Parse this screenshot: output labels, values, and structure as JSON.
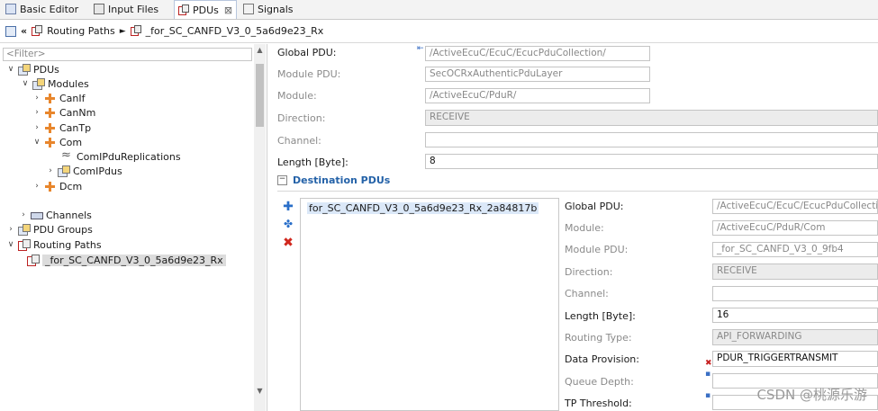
{
  "tabs": [
    {
      "label": "Basic Editor"
    },
    {
      "label": "Input Files"
    },
    {
      "label": "PDUs",
      "close": "⊠"
    },
    {
      "label": "Signals"
    }
  ],
  "breadcrumb": {
    "back": "«",
    "item1": "Routing Paths",
    "sep": "►",
    "item2": "_for_SC_CANFD_V3_0_5a6d9e23_Rx"
  },
  "tree": {
    "filter_placeholder": "<Filter>",
    "nodes": [
      {
        "label": "PDUs"
      },
      {
        "label": "Modules"
      },
      {
        "label": "CanIf"
      },
      {
        "label": "CanNm"
      },
      {
        "label": "CanTp"
      },
      {
        "label": "Com"
      },
      {
        "label": "ComIPduReplications"
      },
      {
        "label": "ComIPdus"
      },
      {
        "label": "Dcm"
      },
      {
        "label": "Channels"
      },
      {
        "label": "PDU Groups"
      },
      {
        "label": "Routing Paths"
      },
      {
        "label": "_for_SC_CANFD_V3_0_5a6d9e23_Rx"
      }
    ]
  },
  "form": {
    "global_pdu": {
      "label": "Global PDU:",
      "value": "/ActiveEcuC/EcuC/EcucPduCollection/"
    },
    "module_pdu": {
      "label": "Module PDU:",
      "value": "SecOCRxAuthenticPduLayer"
    },
    "module": {
      "label": "Module:",
      "value": "/ActiveEcuC/PduR/"
    },
    "direction": {
      "label": "Direction:",
      "value": "RECEIVE"
    },
    "channel": {
      "label": "Channel:",
      "value": ""
    },
    "length": {
      "label": "Length [Byte]:",
      "value": "8"
    }
  },
  "destination": {
    "title": "Destination PDUs",
    "collapse": "−",
    "item": "for_SC_CANFD_V3_0_5a6d9e23_Rx_2a84817b",
    "fields": {
      "global_pdu": {
        "label": "Global PDU:",
        "value": "/ActiveEcuC/EcuC/EcucPduCollection"
      },
      "module": {
        "label": "Module:",
        "value": "/ActiveEcuC/PduR/Com"
      },
      "module_pdu": {
        "label": "Module PDU:",
        "value": "_for_SC_CANFD_V3_0_9fb4"
      },
      "direction": {
        "label": "Direction:",
        "value": "RECEIVE"
      },
      "channel": {
        "label": "Channel:",
        "value": ""
      },
      "length": {
        "label": "Length [Byte]:",
        "value": "16"
      },
      "routing_type": {
        "label": "Routing Type:",
        "value": "API_FORWARDING"
      },
      "data_provision": {
        "label": "Data Provision:",
        "value": "PDUR_TRIGGERTRANSMIT"
      },
      "queue_depth": {
        "label": "Queue Depth:",
        "value": ""
      },
      "tp_threshold": {
        "label": "TP Threshold:",
        "value": ""
      }
    }
  },
  "watermark": "CSDN @桃源乐游",
  "colors": {
    "section_title": "#2462a8",
    "error_mark": "#c62020",
    "add_button": "#2a6fc9",
    "delete_button": "#d0271d"
  }
}
